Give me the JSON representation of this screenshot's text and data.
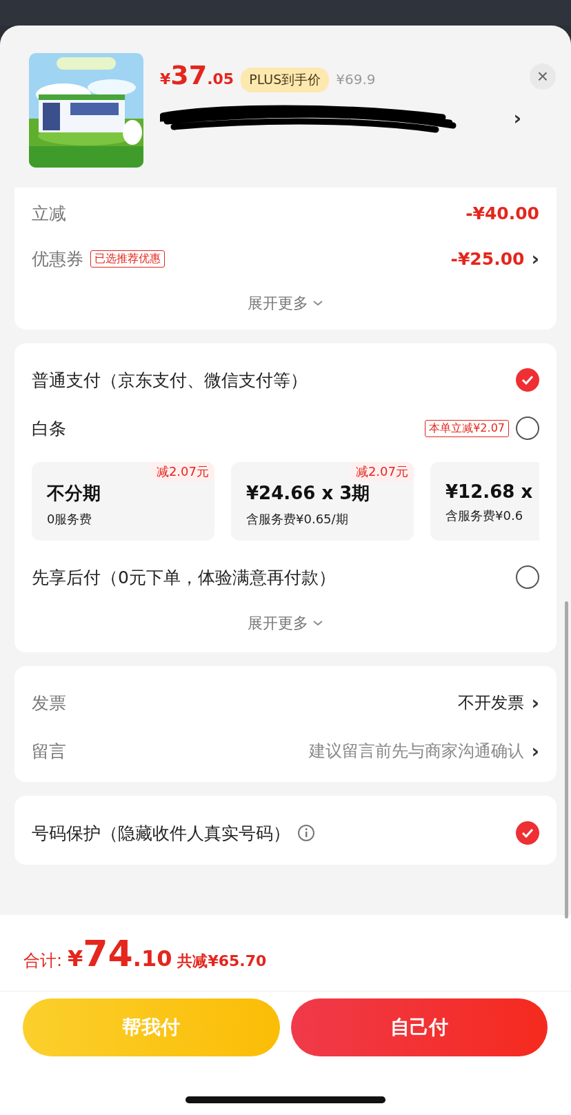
{
  "product": {
    "kind": "picture",
    "price_symbol": "¥",
    "price_integer": "37",
    "price_decimal": ".05",
    "price_tag": "PLUS到手价",
    "original_price": "¥69.9",
    "address_redacted": true,
    "chevron": "›",
    "close": "×"
  },
  "discounts": {
    "rows": [
      {
        "label": "立减",
        "value": "-¥40.00"
      },
      {
        "label": "优惠券",
        "tag": "已选推荐优惠",
        "value": "-¥25.00",
        "chevron": "›"
      }
    ],
    "expand": "展开更多"
  },
  "payment": {
    "options": [
      {
        "label": "普通支付（京东支付、微信支付等）",
        "selected": true
      },
      {
        "label": "白条",
        "tag": "本单立减¥2.07",
        "selected": false
      },
      {
        "label": "先享后付（0元下单，体验满意再付款）",
        "selected": false
      }
    ],
    "installments": [
      {
        "badge": "减2.07元",
        "title": "不分期",
        "subtitle": "0服务费"
      },
      {
        "badge": "减2.07元",
        "title": "¥24.66 x 3期",
        "subtitle": "含服务费¥0.65/期"
      },
      {
        "title": "¥12.68 x",
        "subtitle": "含服务费¥0.6"
      }
    ],
    "expand": "展开更多"
  },
  "extras": [
    {
      "label": "发票",
      "value": "不开发票",
      "chevron": "›",
      "kind": "value"
    },
    {
      "label": "留言",
      "value": "建议留言前先与商家沟通确认",
      "chevron": "›",
      "kind": "hint"
    }
  ],
  "privacy": {
    "label": "号码保护（隐藏收件人真实号码）",
    "checked": true
  },
  "total": {
    "label": "合计:",
    "symbol": "¥",
    "integer": "74",
    "decimal": ".10",
    "saved": "共减¥65.70"
  },
  "buttons": [
    {
      "label": "帮我付",
      "kind": "secondary"
    },
    {
      "label": "自己付",
      "kind": "primary"
    }
  ]
}
